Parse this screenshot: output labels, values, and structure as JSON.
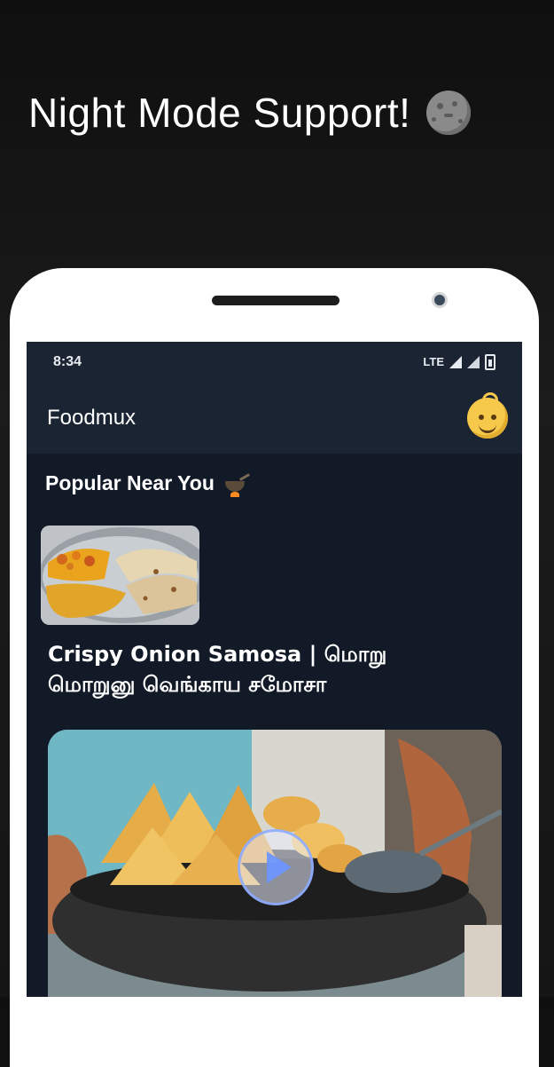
{
  "promo": {
    "headline": "Night Mode Support!",
    "headline_icon": "baby-face-icon"
  },
  "status_bar": {
    "time": "8:34",
    "network": "LTE",
    "icons": [
      "signal-icon",
      "signal-icon",
      "battery-icon"
    ]
  },
  "app_bar": {
    "title": "Foodmux",
    "avatar_icon": "smiling-face-icon"
  },
  "popular": {
    "title": "Popular Near You",
    "title_icon": "cooking-pot-icon",
    "items": [
      {
        "image": "thali-plate-image"
      }
    ]
  },
  "featured": {
    "title": "Crispy Onion Samosa | மொறு மொறுனு வெங்காய சமோசா",
    "video_image": "samosa-frying-image",
    "play_icon": "play-icon"
  },
  "colors": {
    "screen_bg": "#111a26",
    "bar_bg": "#1b2433",
    "accent_play": "#6e96ff"
  }
}
